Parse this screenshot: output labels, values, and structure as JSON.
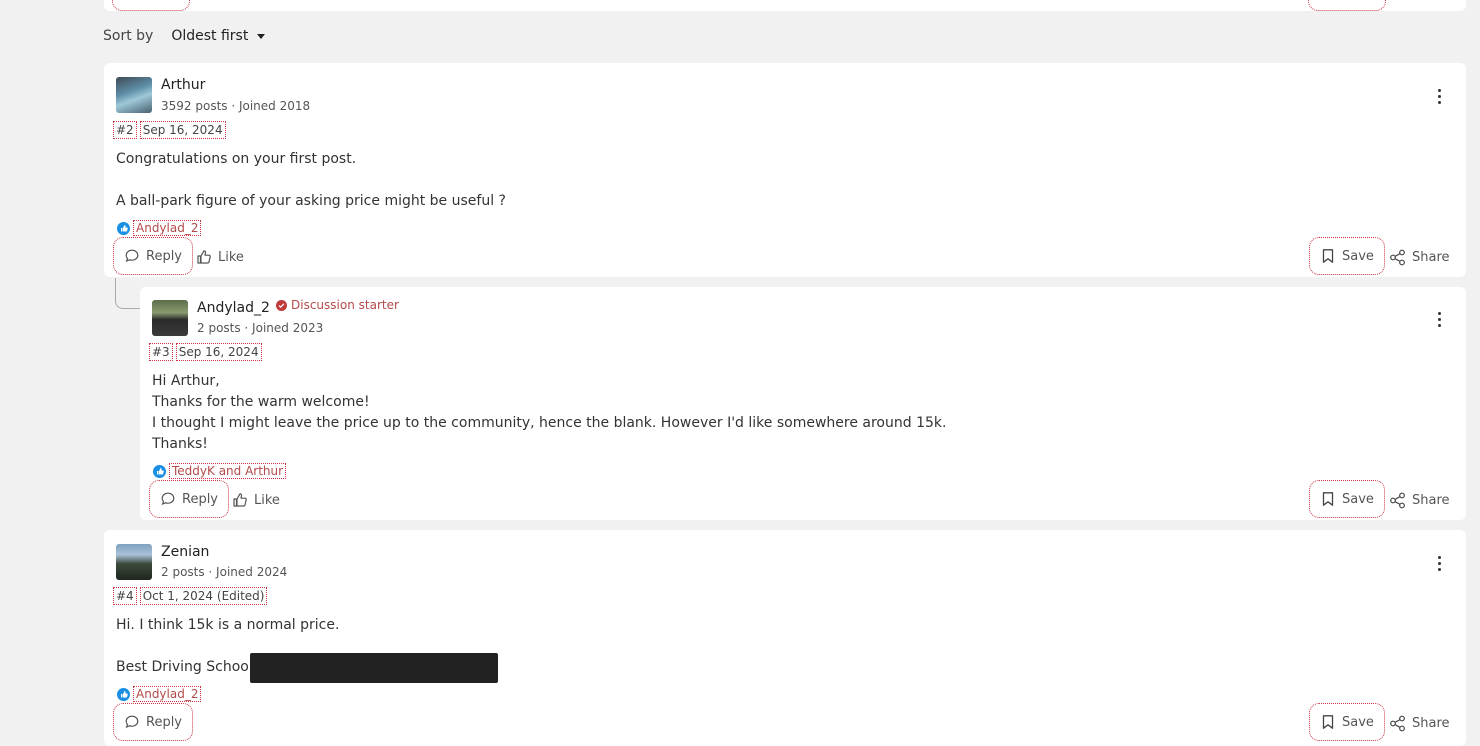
{
  "sort": {
    "label": "Sort by",
    "value": "Oldest first"
  },
  "posts": [
    {
      "username": "Arthur",
      "meta": "3592 posts · Joined 2018",
      "number": "#2",
      "date": "Sep 16, 2024",
      "lines": [
        "Congratulations on your first post.",
        "",
        "A ball-park figure of your asking price might be useful ?"
      ],
      "reactions": "Andylad_2",
      "actions": {
        "reply": "Reply",
        "like": "Like",
        "save": "Save",
        "share": "Share"
      }
    },
    {
      "username": "Andylad_2",
      "badge": "Discussion starter",
      "meta": "2 posts · Joined 2023",
      "number": "#3",
      "date": "Sep 16, 2024",
      "lines": [
        "Hi Arthur,",
        "Thanks for the warm welcome!",
        "I thought I might leave the price up to the community, hence the blank. However I'd like somewhere around 15k.",
        "Thanks!"
      ],
      "reactions": "TeddyK and Arthur",
      "actions": {
        "reply": "Reply",
        "like": "Like",
        "save": "Save",
        "share": "Share"
      }
    },
    {
      "username": "Zenian",
      "meta": "2 posts · Joined 2024",
      "number": "#4",
      "date": "Oct 1, 2024 (Edited)",
      "lines": [
        "Hi. I think 15k is a normal price.",
        "",
        "Best Driving School -"
      ],
      "reactions": "Andylad_2",
      "actions": {
        "reply": "Reply",
        "save": "Save",
        "share": "Share"
      }
    }
  ],
  "colors": {
    "accent": "#b44a4a",
    "react": "#1a8fe3",
    "badge": "#c0393b"
  }
}
